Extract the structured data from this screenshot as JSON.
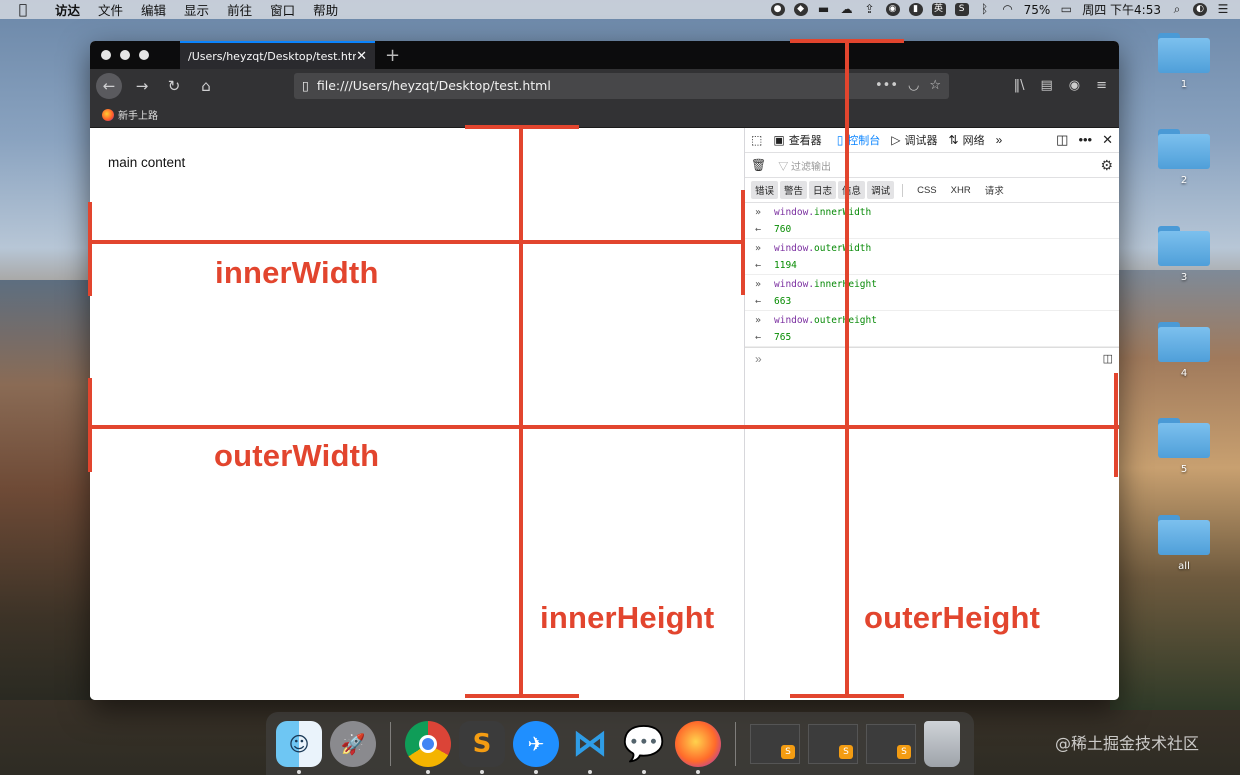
{
  "menubar": {
    "items": [
      "访达",
      "文件",
      "编辑",
      "显示",
      "前往",
      "窗口",
      "帮助"
    ],
    "battery": "75%",
    "clock": "周四 下午4:53",
    "status_icons": [
      "wechat-icon",
      "vpn-icon",
      "docker-icon",
      "cloud-icon",
      "upload-icon",
      "qq-icon",
      "mic-icon",
      "input-method-icon",
      "sublime-icon",
      "bluetooth-icon",
      "wifi-icon",
      "battery-icon",
      "search-icon",
      "siri-icon",
      "control-center-icon"
    ],
    "input_method": "英"
  },
  "desktop": {
    "folders": [
      "1",
      "2",
      "3",
      "4",
      "5",
      "all"
    ]
  },
  "browser": {
    "tab_title": "/Users/heyzqt/Desktop/test.html",
    "url": "file:///Users/heyzqt/Desktop/test.html",
    "bookmark": "新手上路",
    "page_text": "main content"
  },
  "devtools": {
    "tabs": [
      "查看器",
      "控制台",
      "调试器",
      "网络"
    ],
    "active_tab": "控制台",
    "filter_placeholder": "过滤输出",
    "levels": [
      "错误",
      "警告",
      "日志",
      "信息",
      "调试"
    ],
    "extra_filters": [
      "CSS",
      "XHR",
      "请求"
    ],
    "console": [
      {
        "obj": "window.",
        "prop": "innerWidth",
        "result": "760"
      },
      {
        "obj": "window.",
        "prop": "outerWidth",
        "result": "1194"
      },
      {
        "obj": "window.",
        "prop": "innerHeight",
        "result": "663"
      },
      {
        "obj": "window.",
        "prop": "outerHeight",
        "result": "765"
      }
    ]
  },
  "annotations": {
    "inner_width": "innerWidth",
    "outer_width": "outerWidth",
    "inner_height": "innerHeight",
    "outer_height": "outerHeight",
    "color": "#e2452e"
  },
  "dock": {
    "apps": [
      "finder",
      "launchpad",
      "chrome",
      "sublime-text",
      "feishu",
      "vscode",
      "wechat",
      "firefox"
    ]
  },
  "watermark": "@稀土掘金技术社区"
}
